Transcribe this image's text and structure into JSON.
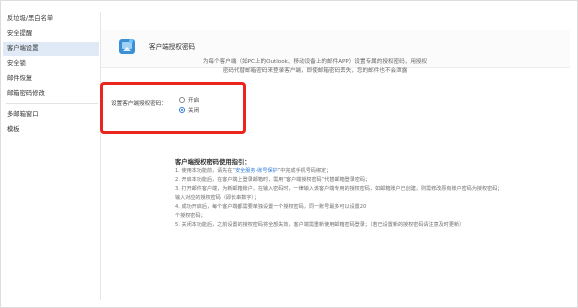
{
  "sidebar": {
    "items": [
      {
        "label": "反垃圾/黑白名单",
        "active": false
      },
      {
        "label": "安全提醒",
        "active": false
      },
      {
        "label": "客户端设置",
        "active": true
      },
      {
        "label": "安全锁",
        "active": false
      },
      {
        "label": "邮件恢复",
        "active": false
      },
      {
        "label": "邮箱密码修改",
        "active": false
      },
      {
        "label": "多邮箱窗口",
        "active": false
      },
      {
        "label": "模板",
        "active": false
      }
    ]
  },
  "page": {
    "title": "客户端授权密码",
    "intro_line1": "为每个客户端（如PC上的Outlook、移动设备上的邮件APP）设置专属的授权密码，用授权",
    "intro_line2": "密码代替邮箱密码来登录客户端，即使邮箱密码丢失，您的邮件也不会泄露"
  },
  "setting": {
    "label": "设置客户端授权密码：",
    "options": [
      {
        "label": "开启",
        "checked": false
      },
      {
        "label": "关闭",
        "checked": true
      }
    ]
  },
  "guide": {
    "title": "客户端授权密码使用指引：",
    "lines": [
      "1. 使用本功能前，请先在“安全服务-账号保护”中完成手机号码绑定；",
      "2. 开启本功能后，在客户端上登录邮箱时，需用“客户端授权密码”代替邮箱登录密码；",
      "3. 打开邮件客户端，为新邮箱账户，在输入密码时，一律输入该客户端专用的授权密码，如邮箱账户已创建，则需修改原有账户密码为授权密码；",
      "   输入对应的授权密码（即长串数字）；",
      "4. 成功开启后，每个客户端都需要单独设置一个授权密码，同一账号最多可以设置20",
      "   个授权密码；",
      "5. 关闭本功能后，之前设置的授权密码将全部失效，客户端需重新使用邮箱密码登录；（若已设置新的授权密码请注意及时更新）"
    ],
    "link_text": "安全服务-账号保护"
  },
  "colors": {
    "highlight_border": "#e8261e",
    "accent": "#2f7bd8",
    "active_item_bg": "#dfeaf6"
  },
  "icons": {
    "app_icon": "client-app-icon"
  }
}
